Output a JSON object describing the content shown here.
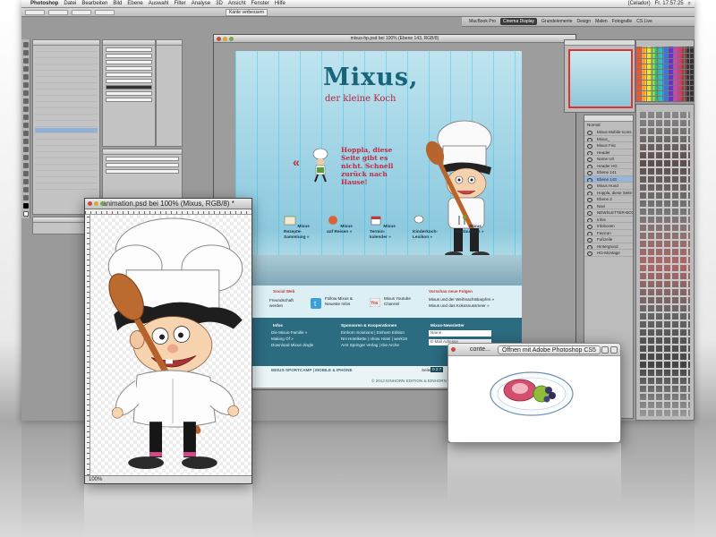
{
  "menubar": {
    "apple": "",
    "app": "Photoshop",
    "items": [
      "Datei",
      "Bearbeiten",
      "Bild",
      "Ebene",
      "Auswahl",
      "Filter",
      "Analyse",
      "3D",
      "Ansicht",
      "Fenster",
      "Hilfe"
    ],
    "status_user": "(Celador)",
    "clock": "Fr. 17:57:25"
  },
  "workspace": {
    "items": [
      "MacBook Pro",
      "Cinema Display",
      "Grundelemente",
      "Design",
      "Malen",
      "Fotografie"
    ],
    "active": "Cinema Display",
    "cs_live": "CS Live"
  },
  "optionsbar": {
    "button": "Kante verbessern"
  },
  "docwin": {
    "title": "mixus-hp.psd bei 100% (Ebene 143, RGB/8)"
  },
  "website": {
    "title": "Mixus,",
    "subtitle": "der kleine Koch",
    "error_arrow": "«",
    "error_text": "Hoppla, diese Seite gibt es nicht. Schnell zurück nach Hause!",
    "nav": [
      "Mixus Rezepte-Sammlung »",
      "Mixus auf Reisen »",
      "Mixus Termin-kalender »",
      "Kinderkoch-Lexikon »",
      "Mixus Restaurants »"
    ],
    "social_heading": "Social Web",
    "social": [
      "Freundschaft werden",
      "Follow Mixus & Neueste Infos",
      "Mixus Youtube Channel"
    ],
    "vorschau_heading": "Vorschau neue Folgen",
    "vorschau": [
      "Mixus und der Weihnachtskarpfen »",
      "Mixus und das Kokosnussmeer »"
    ],
    "infos_heading": "Infos",
    "infos": [
      "Die Mixus-Familie »",
      "Making Of »",
      "Download Mixus-Jingle"
    ],
    "sponsors_heading": "Sponsoren & Kooperationen",
    "sponsors": [
      "Einhorn Solutions | Einhorn Edition",
      "NH Hotelkette | nhow Hotel | werk18",
      "Arnt Springer Verlag | Die Arche"
    ],
    "newsletter_heading": "Mixus-Newsletter",
    "newsletter_name": "Name",
    "newsletter_email": "E-Mail Adresse",
    "newsletter_button": "Jetzt bestellen »",
    "footer_links": "MIXUS-SPORTCAMP | MOBILE & IPHONE",
    "pager_label": "Seite",
    "pager": "0 2 7",
    "pager_suffix": "Tage bis",
    "copyright": "© 2012 EINHORN EDITION & EINHORN SOLUTIONS"
  },
  "animwin": {
    "title": "animation.psd bei 100% (Mixus, RGB/8) *",
    "zoom": "100%"
  },
  "qlwin": {
    "title": "conte...",
    "open_button": "Öffnen mit Adobe Photoshop CS5"
  },
  "layers": {
    "blend": "Normal",
    "rows": [
      "Mixus Mobile-Icons",
      "Mixus_",
      "Mixus Fisc",
      "Header",
      "Name Url",
      "Header HG",
      "Ebene 141",
      "Ebene 143",
      "Mixus Hund",
      "Hoppla, diese Seite gibt es nicht",
      "Ebene 2",
      "Navi",
      "NEWSLETTER-BOX",
      "Infos",
      "Infoboxen",
      "Favicon",
      "Fußzeile",
      "Hintergrund",
      "HG-Montage"
    ],
    "selected_index": 7
  },
  "colors": {
    "accent_red": "#c02a42",
    "teal_dark": "#2c6c81",
    "title_teal": "#18647a"
  }
}
